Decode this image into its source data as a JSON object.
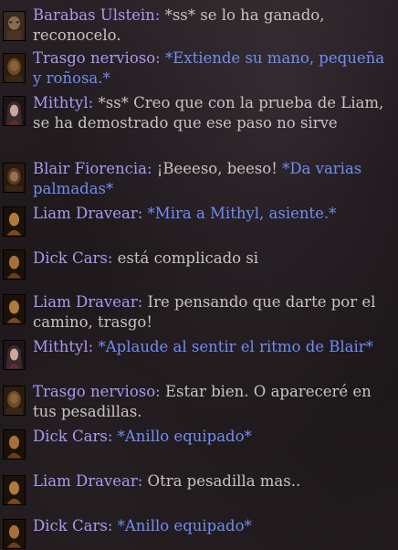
{
  "chat": {
    "messages": [
      {
        "portrait": "barabas-portrait",
        "name": "Barabas Ulstein",
        "sep": ": ",
        "text": "*ss* se lo ha ganado, reconocelo.",
        "emote": ""
      },
      {
        "portrait": "trasgo-portrait",
        "name": "Trasgo nervioso",
        "sep": ": ",
        "text": "",
        "emote": "*Extiende su mano, pequeña y roñosa.*"
      },
      {
        "portrait": "mithtyl-portrait",
        "name": "Mithtyl",
        "sep": ": ",
        "text": "*ss* Creo que con la prueba de Liam, se ha demostrado que ese paso no sirve",
        "emote": ""
      },
      {
        "portrait": "blair-portrait",
        "name": "Blair Fiorencia",
        "sep": ": ",
        "text": "¡Beeeso, beeso! ",
        "emote": "*Da varias palmadas*"
      },
      {
        "portrait": "liam-portrait",
        "name": "Liam Dravear",
        "sep": ": ",
        "text": "",
        "emote": "*Mira a Mithyl, asiente.*"
      },
      {
        "portrait": "dick-portrait",
        "name": "Dick Cars",
        "sep": ": ",
        "text": "está complicado si",
        "emote": ""
      },
      {
        "portrait": "liam-portrait",
        "name": "Liam Dravear",
        "sep": ": ",
        "text": "Ire pensando que darte por el camino, trasgo!",
        "emote": ""
      },
      {
        "portrait": "mithtyl-portrait",
        "name": "Mithtyl",
        "sep": ": ",
        "text": "",
        "emote": "*Aplaude al sentir el ritmo de Blair*"
      },
      {
        "portrait": "trasgo-portrait",
        "name": "Trasgo nervioso",
        "sep": ": ",
        "text": "Estar bien. O apareceré en tus pesadillas.",
        "emote": ""
      },
      {
        "portrait": "dick-portrait",
        "name": "Dick Cars",
        "sep": ": ",
        "text": "",
        "emote": "*Anillo equipado*"
      },
      {
        "portrait": "liam-portrait",
        "name": "Liam Dravear",
        "sep": ": ",
        "text": "Otra pesadilla mas..",
        "emote": ""
      },
      {
        "portrait": "dick-portrait",
        "name": "Dick Cars",
        "sep": ": ",
        "text": "",
        "emote": "*Anillo equipado*"
      }
    ]
  },
  "colors": {
    "name": "#a79af0",
    "emote": "#6f8ef4",
    "text": "#c7c3c5",
    "background": "#1b1619"
  }
}
